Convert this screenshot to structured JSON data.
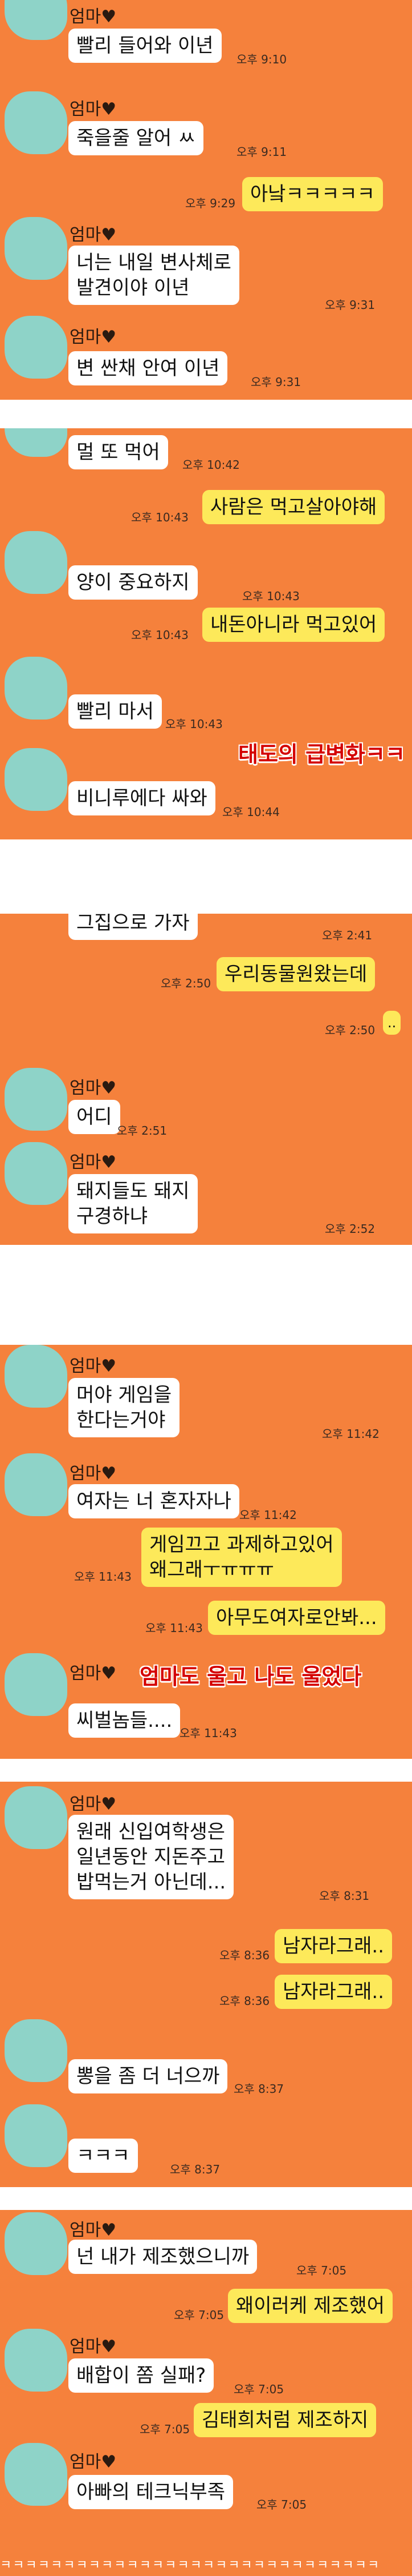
{
  "sender_name": "엄마♥",
  "panel1": {
    "messages": [
      {
        "text": "빨리 들어와 이년",
        "time": "오후 9:10"
      },
      {
        "text": "죽을줄 알어  ㅆ",
        "time": "오후 9:11"
      },
      {
        "text": "아낰ㅋㅋㅋㅋㅋ",
        "time": "오후 9:29"
      },
      {
        "text": "너는 내일 변사체로\n발견이야 이년",
        "time": "오후 9:31"
      },
      {
        "text": "변 싼채  안여 이년",
        "time": "오후 9:31"
      }
    ]
  },
  "panel2": {
    "messages": [
      {
        "text": "멀 또 먹어",
        "time": "오후 10:42"
      },
      {
        "text": "사람은 먹고살아야해",
        "time": "오후 10:43"
      },
      {
        "text": "양이 중요하지",
        "time": "오후 10:43"
      },
      {
        "text": "내돈아니라 먹고있어",
        "time": "오후 10:43"
      },
      {
        "text": "빨리 마서",
        "time": "오후 10:43"
      },
      {
        "text": "비니루에다 싸와",
        "time": "오후 10:44"
      }
    ],
    "overlay": "태도의 급변화ㅋㅋ"
  },
  "panel3": {
    "messages": [
      {
        "text": "그집으로 가자",
        "time": "오후 2:41"
      },
      {
        "text": "우리동물원왔는데",
        "time": "오후 2:50"
      },
      {
        "text": "..",
        "time": "오후 2:50"
      },
      {
        "text": "어디",
        "time": "오후 2:51"
      },
      {
        "text": "돼지들도 돼지\n구경하냐",
        "time": "오후 2:52"
      }
    ]
  },
  "panel4": {
    "messages": [
      {
        "text": "머야 게임을\n한다는거야",
        "time": "오후 11:42"
      },
      {
        "text": "여자는 너 혼자자나",
        "time": "오후 11:42"
      },
      {
        "text": "게임끄고 과제하고있어\n왜그래ㅜㅠㅠㅠ",
        "time": "오후 11:43"
      },
      {
        "text": "아무도여자로안봐...",
        "time": "오후 11:43"
      },
      {
        "text": "씨벌놈들....",
        "time": "오후 11:43"
      }
    ],
    "overlay": "엄마도 울고 나도 울었다"
  },
  "panel5": {
    "messages": [
      {
        "text": "원래 신입여학생은\n일년동안 지돈주고\n밥먹는거 아닌데...",
        "time": "오후 8:31"
      },
      {
        "text": "남자라그래..",
        "time": "오후 8:36"
      },
      {
        "text": "남자라그래..",
        "time": "오후 8:36"
      },
      {
        "text": "뽕을 좀 더 너으까",
        "time": "오후 8:37"
      },
      {
        "text": "ㅋㅋㅋ",
        "time": "오후 8:37"
      }
    ]
  },
  "panel6": {
    "messages": [
      {
        "text": "넌 내가 제조했으니까",
        "time": "오후 7:05"
      },
      {
        "text": "왜이러케 제조했어",
        "time": "오후 7:05"
      },
      {
        "text": "배합이 쫌 실패?",
        "time": "오후 7:05"
      },
      {
        "text": "김태희처럼 제조하지",
        "time": "오후 7:05"
      },
      {
        "text": "아빠의 테크닉부족",
        "time": "오후 7:05"
      }
    ]
  },
  "footer_text": "ㅋㅋㅋㅋㅋㅋㅋㅋㅋㅋㅋㅋㅋㅋㅋㅋㅋㅋㅋㅋㅋㅋㅋㅋㅋㅋㅋㅋㅋㅋ",
  "colors": {
    "chat_background": "#f5813c",
    "incoming_bubble": "#ffffff",
    "outgoing_bubble": "#fde95a",
    "avatar_blur": "#8ed3c8",
    "overlay_text": "#d40000"
  }
}
